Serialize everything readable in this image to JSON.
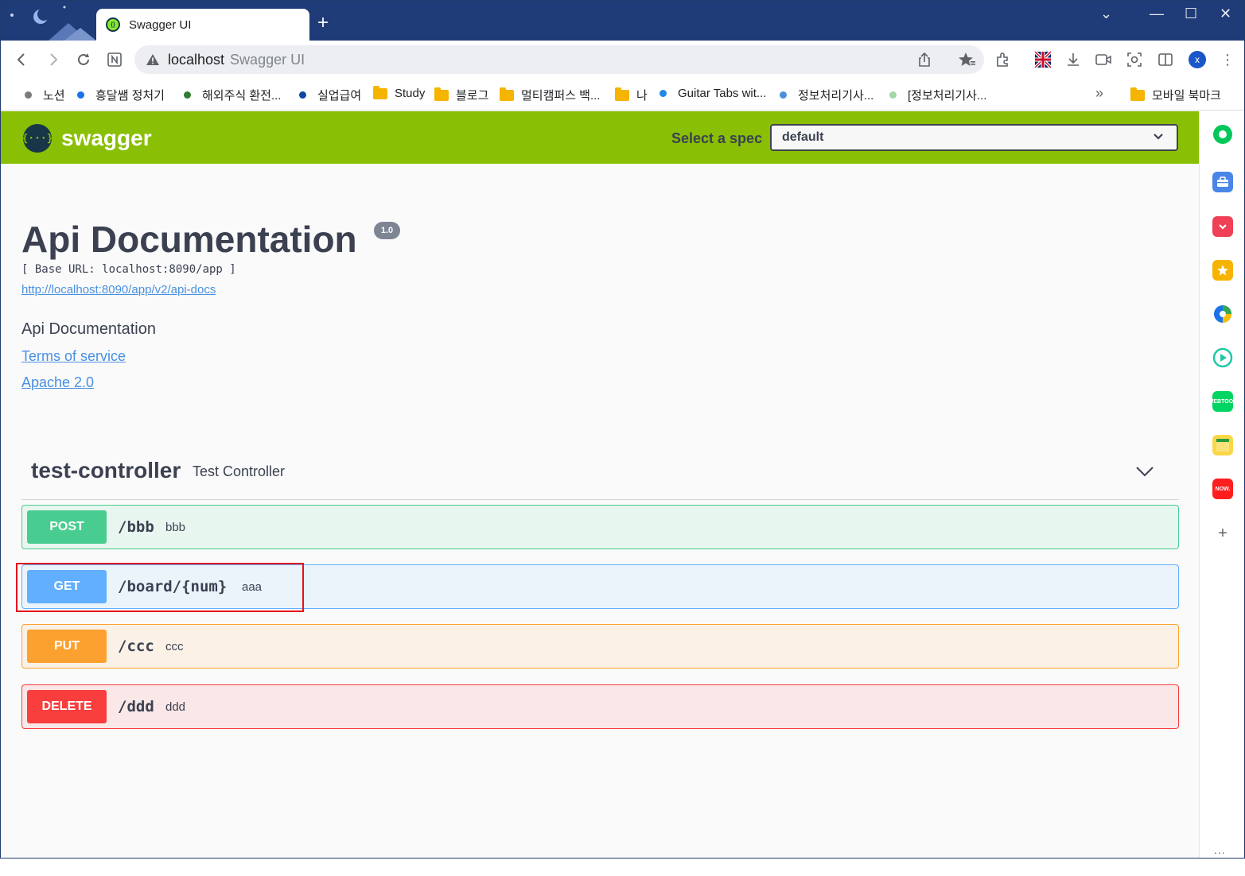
{
  "browser": {
    "tab_title": "Swagger UI",
    "new_tab": "+",
    "window_controls": {
      "dropdown": "⌄",
      "minimize": "—",
      "maximize": "☐",
      "close": "✕"
    },
    "omnibox": {
      "host": "localhost",
      "title": "Swagger UI"
    },
    "profile_initial": "x",
    "more": "⋮"
  },
  "bookmarks": {
    "items": [
      {
        "label": "노션",
        "kind": "dot",
        "color": "#7a7a7a"
      },
      {
        "label": "흥달쌤 정처기",
        "kind": "dot",
        "color": "#1a73e8"
      },
      {
        "label": "해외주식 환전...",
        "kind": "dot",
        "color": "#2e7d32"
      },
      {
        "label": "실업급여",
        "kind": "dot",
        "color": "#0d47a1"
      },
      {
        "label": "Study",
        "kind": "folder"
      },
      {
        "label": "블로그",
        "kind": "folder"
      },
      {
        "label": "멀티캠퍼스 백...",
        "kind": "folder"
      },
      {
        "label": "나",
        "kind": "folder"
      },
      {
        "label": "Guitar Tabs wit...",
        "kind": "dot",
        "color": "#1e88e5"
      },
      {
        "label": "정보처리기사...",
        "kind": "dot",
        "color": "#4a90d9"
      },
      {
        "label": "[정보처리기사...",
        "kind": "dot",
        "color": "#a5d6a7"
      }
    ],
    "overflow": "»",
    "mobile_folder": "모바일 북마크"
  },
  "swagger": {
    "brand": "swagger",
    "spec_label": "Select a spec",
    "spec_value": "default",
    "title": "Api Documentation",
    "version": "1.0",
    "base_url": "[ Base URL: localhost:8090/app ]",
    "docs_link": "http://localhost:8090/app/v2/api-docs",
    "description": "Api Documentation",
    "terms": "Terms of service",
    "license": "Apache 2.0",
    "tag": {
      "name": "test-controller",
      "description": "Test Controller"
    },
    "operations": [
      {
        "method": "POST",
        "path": "/bbb",
        "summary": "bbb"
      },
      {
        "method": "GET",
        "path": "/board/{num}",
        "summary": "aaa"
      },
      {
        "method": "PUT",
        "path": "/ccc",
        "summary": "ccc"
      },
      {
        "method": "DELETE",
        "path": "/ddd",
        "summary": "ddd"
      }
    ]
  },
  "sidepanel": {
    "icons": [
      "naver-circle-icon",
      "briefcase-icon",
      "pocket-icon",
      "star-icon",
      "edge-pie-icon",
      "play-icon",
      "webtoon-icon",
      "notes-icon",
      "now-icon",
      "add-icon"
    ],
    "webtoon_label": "WEBTOON",
    "now_label": "NOW.",
    "add_label": "+",
    "dots": "..."
  },
  "colors": {
    "swagger_green": "#89bf04",
    "post": "#49cc90",
    "get": "#61affe",
    "put": "#fca130",
    "delete": "#f93e3e",
    "highlight": "#e3141b"
  }
}
